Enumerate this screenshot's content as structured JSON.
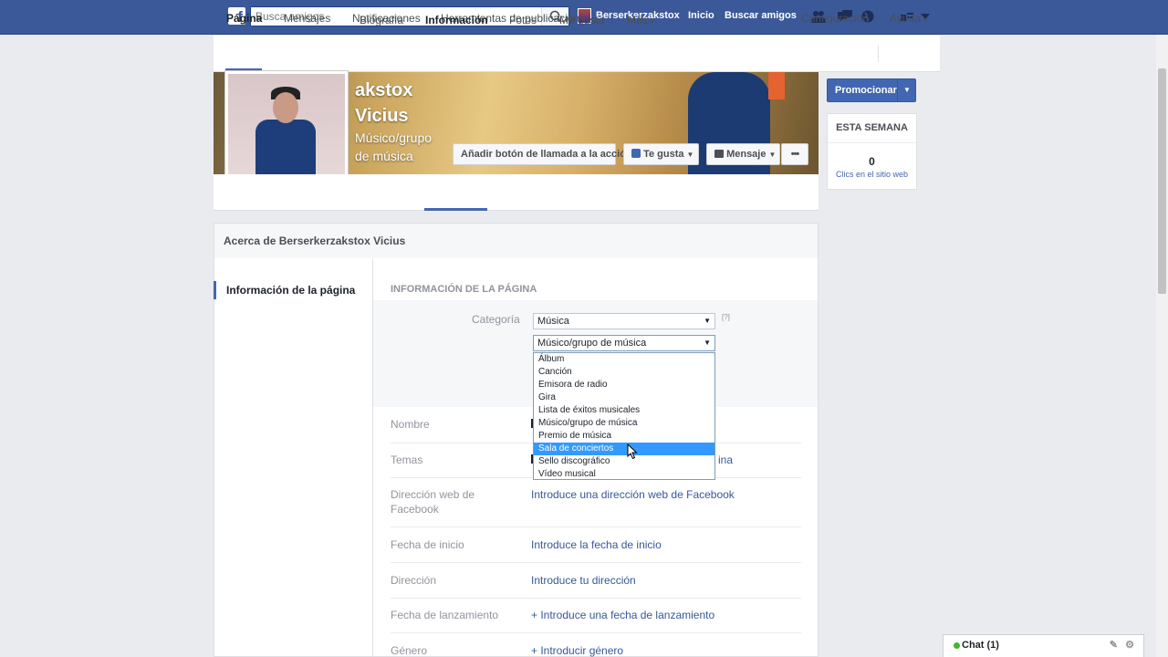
{
  "topbar": {
    "search_placeholder": "Busca amigos",
    "user_name": "Berserkerzakstox",
    "home_link": "Inicio",
    "find_friends_link": "Buscar amigos"
  },
  "pagenav": {
    "page": "Página",
    "messages": "Mensajes",
    "notifications": "Notificaciones",
    "publishing_tools": "Herramientas de publicación",
    "settings": "Configuración",
    "help": "Ayuda"
  },
  "cover": {
    "name_line1": "akstox",
    "name_line2": "Vicius",
    "category_line1": "Músico/grupo",
    "category_line2": "de música",
    "cta_button": "Añadir botón de llamada a la acción",
    "like_button": "Te gusta",
    "message_button": "Mensaje",
    "more_button": "•••"
  },
  "tabs": [
    "Biografía",
    "Información",
    "Fotos",
    "Me gusta",
    "Más"
  ],
  "sidebar_right": {
    "promote": "Promocionar",
    "week_title": "ESTA SEMANA",
    "week_count": "0",
    "week_caption": "Clics en el sitio web"
  },
  "about": {
    "header": "Acerca de Berserkerzakstox Vicius",
    "left_item": "Información de la página",
    "section_title": "INFORMACIÓN DE LA PÁGINA",
    "category_label": "Categoría",
    "help_mark": "[?]",
    "category_select": "Música",
    "subcategory_select": "Músico/grupo de música",
    "dropdown_options": [
      "Álbum",
      "Canción",
      "Emisora de radio",
      "Gira",
      "Lista de éxitos musicales",
      "Músico/grupo de música",
      "Premio de música",
      "Sala de conciertos",
      "Sello discográfico",
      "Vídeo musical"
    ],
    "highlighted_option": "Sala de conciertos",
    "rows": [
      {
        "label": "Nombre",
        "value": ""
      },
      {
        "label": "Temas",
        "value": "ina"
      },
      {
        "label": "Dirección web de Facebook",
        "value": "Introduce una dirección web de Facebook"
      },
      {
        "label": "Fecha de inicio",
        "value": "Introduce la fecha de inicio"
      },
      {
        "label": "Dirección",
        "value": "Introduce tu dirección"
      },
      {
        "label": "Fecha de lanzamiento",
        "value": "+ Introduce una fecha de lanzamiento"
      },
      {
        "label": "Género",
        "value": "+ Introducir género"
      }
    ]
  },
  "chat": {
    "label": "Chat (1)"
  },
  "colors": {
    "facebook_blue": "#3b5998",
    "link_blue": "#365899",
    "highlight": "#3399ff"
  }
}
